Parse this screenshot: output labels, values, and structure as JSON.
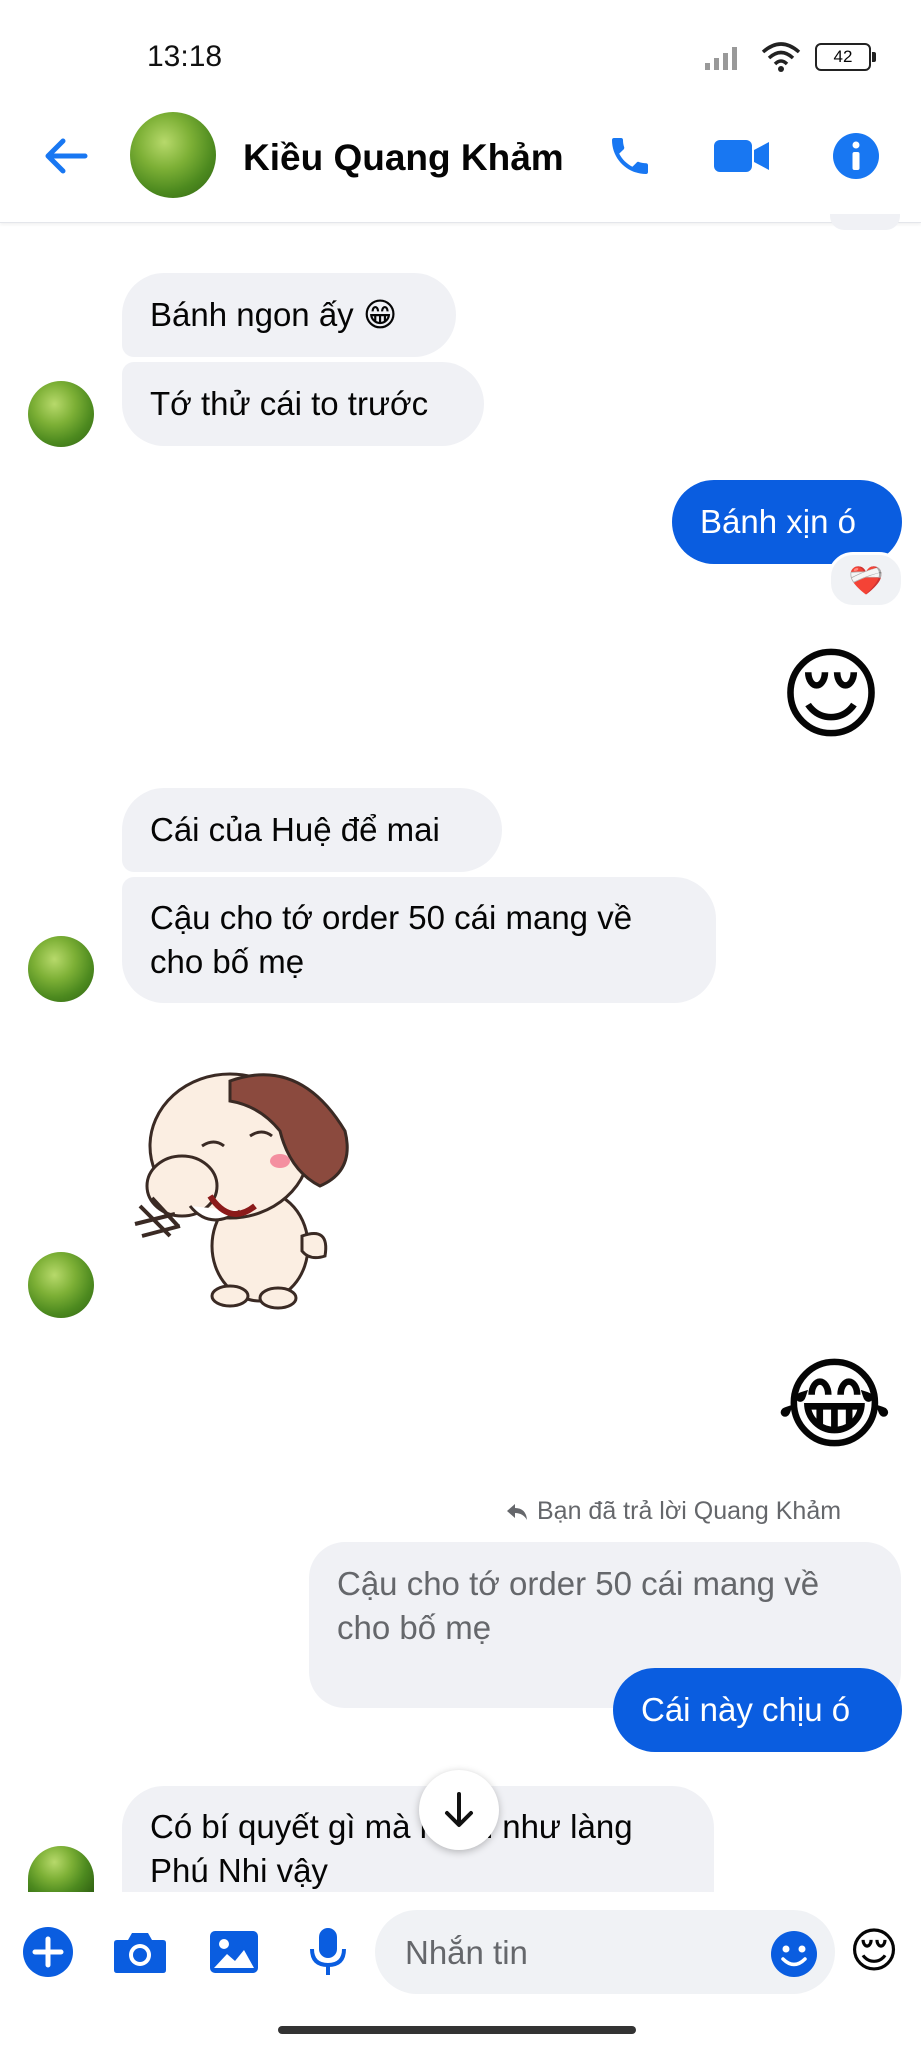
{
  "status": {
    "time": "13:18",
    "battery": "42"
  },
  "header": {
    "contact_name": "Kiều Quang Khảm"
  },
  "messages": {
    "m1": "Bánh ngon ấy 😁",
    "m2": "Tớ thử cái to trước",
    "m3": "Bánh xịn ó",
    "m3_reaction": "❤️‍🩹",
    "m4_emoji": "😌",
    "m5": "Cái của Huệ để mai",
    "m6_line1": "Cậu cho tớ order 50 cái mang về",
    "m6_line2": "cho bố mẹ",
    "m7_sticker": "dog-laughing-sticker",
    "m8_emoji": "😂",
    "reply_note": "Bạn đã trả lời Quang Khảm",
    "quoted_line1": "Cậu cho tớ order 50 cái mang về",
    "quoted_line2": "cho bố mẹ",
    "m9": "Cái này chịu ó",
    "m10_line1": "Có bí quyết gì mà ngon như làng",
    "m10_line2": "Phú Nhi vậy"
  },
  "composer": {
    "placeholder": "Nhắn tin",
    "quick_reaction": "😌"
  },
  "colors": {
    "accent": "#0a5de0",
    "incoming_bubble": "#f0f1f5",
    "icon_blue": "#1877f2"
  }
}
